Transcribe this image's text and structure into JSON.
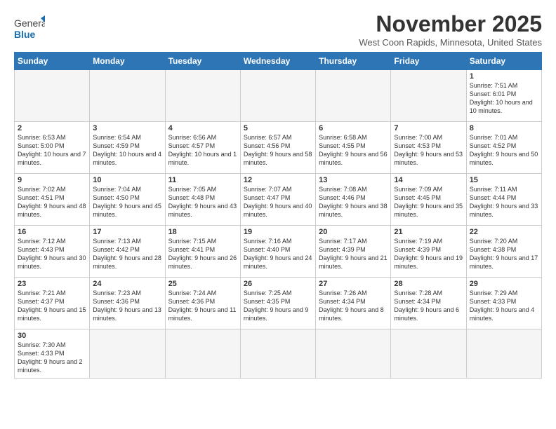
{
  "header": {
    "logo_general": "General",
    "logo_blue": "Blue",
    "month_title": "November 2025",
    "subtitle": "West Coon Rapids, Minnesota, United States"
  },
  "weekdays": [
    "Sunday",
    "Monday",
    "Tuesday",
    "Wednesday",
    "Thursday",
    "Friday",
    "Saturday"
  ],
  "weeks": [
    [
      {
        "day": "",
        "info": ""
      },
      {
        "day": "",
        "info": ""
      },
      {
        "day": "",
        "info": ""
      },
      {
        "day": "",
        "info": ""
      },
      {
        "day": "",
        "info": ""
      },
      {
        "day": "",
        "info": ""
      },
      {
        "day": "1",
        "info": "Sunrise: 7:51 AM\nSunset: 6:01 PM\nDaylight: 10 hours\nand 10 minutes."
      }
    ],
    [
      {
        "day": "2",
        "info": "Sunrise: 6:53 AM\nSunset: 5:00 PM\nDaylight: 10 hours\nand 7 minutes."
      },
      {
        "day": "3",
        "info": "Sunrise: 6:54 AM\nSunset: 4:59 PM\nDaylight: 10 hours\nand 4 minutes."
      },
      {
        "day": "4",
        "info": "Sunrise: 6:56 AM\nSunset: 4:57 PM\nDaylight: 10 hours\nand 1 minute."
      },
      {
        "day": "5",
        "info": "Sunrise: 6:57 AM\nSunset: 4:56 PM\nDaylight: 9 hours\nand 58 minutes."
      },
      {
        "day": "6",
        "info": "Sunrise: 6:58 AM\nSunset: 4:55 PM\nDaylight: 9 hours\nand 56 minutes."
      },
      {
        "day": "7",
        "info": "Sunrise: 7:00 AM\nSunset: 4:53 PM\nDaylight: 9 hours\nand 53 minutes."
      },
      {
        "day": "8",
        "info": "Sunrise: 7:01 AM\nSunset: 4:52 PM\nDaylight: 9 hours\nand 50 minutes."
      }
    ],
    [
      {
        "day": "9",
        "info": "Sunrise: 7:02 AM\nSunset: 4:51 PM\nDaylight: 9 hours\nand 48 minutes."
      },
      {
        "day": "10",
        "info": "Sunrise: 7:04 AM\nSunset: 4:50 PM\nDaylight: 9 hours\nand 45 minutes."
      },
      {
        "day": "11",
        "info": "Sunrise: 7:05 AM\nSunset: 4:48 PM\nDaylight: 9 hours\nand 43 minutes."
      },
      {
        "day": "12",
        "info": "Sunrise: 7:07 AM\nSunset: 4:47 PM\nDaylight: 9 hours\nand 40 minutes."
      },
      {
        "day": "13",
        "info": "Sunrise: 7:08 AM\nSunset: 4:46 PM\nDaylight: 9 hours\nand 38 minutes."
      },
      {
        "day": "14",
        "info": "Sunrise: 7:09 AM\nSunset: 4:45 PM\nDaylight: 9 hours\nand 35 minutes."
      },
      {
        "day": "15",
        "info": "Sunrise: 7:11 AM\nSunset: 4:44 PM\nDaylight: 9 hours\nand 33 minutes."
      }
    ],
    [
      {
        "day": "16",
        "info": "Sunrise: 7:12 AM\nSunset: 4:43 PM\nDaylight: 9 hours\nand 30 minutes."
      },
      {
        "day": "17",
        "info": "Sunrise: 7:13 AM\nSunset: 4:42 PM\nDaylight: 9 hours\nand 28 minutes."
      },
      {
        "day": "18",
        "info": "Sunrise: 7:15 AM\nSunset: 4:41 PM\nDaylight: 9 hours\nand 26 minutes."
      },
      {
        "day": "19",
        "info": "Sunrise: 7:16 AM\nSunset: 4:40 PM\nDaylight: 9 hours\nand 24 minutes."
      },
      {
        "day": "20",
        "info": "Sunrise: 7:17 AM\nSunset: 4:39 PM\nDaylight: 9 hours\nand 21 minutes."
      },
      {
        "day": "21",
        "info": "Sunrise: 7:19 AM\nSunset: 4:39 PM\nDaylight: 9 hours\nand 19 minutes."
      },
      {
        "day": "22",
        "info": "Sunrise: 7:20 AM\nSunset: 4:38 PM\nDaylight: 9 hours\nand 17 minutes."
      }
    ],
    [
      {
        "day": "23",
        "info": "Sunrise: 7:21 AM\nSunset: 4:37 PM\nDaylight: 9 hours\nand 15 minutes."
      },
      {
        "day": "24",
        "info": "Sunrise: 7:23 AM\nSunset: 4:36 PM\nDaylight: 9 hours\nand 13 minutes."
      },
      {
        "day": "25",
        "info": "Sunrise: 7:24 AM\nSunset: 4:36 PM\nDaylight: 9 hours\nand 11 minutes."
      },
      {
        "day": "26",
        "info": "Sunrise: 7:25 AM\nSunset: 4:35 PM\nDaylight: 9 hours\nand 9 minutes."
      },
      {
        "day": "27",
        "info": "Sunrise: 7:26 AM\nSunset: 4:34 PM\nDaylight: 9 hours\nand 8 minutes."
      },
      {
        "day": "28",
        "info": "Sunrise: 7:28 AM\nSunset: 4:34 PM\nDaylight: 9 hours\nand 6 minutes."
      },
      {
        "day": "29",
        "info": "Sunrise: 7:29 AM\nSunset: 4:33 PM\nDaylight: 9 hours\nand 4 minutes."
      }
    ],
    [
      {
        "day": "30",
        "info": "Sunrise: 7:30 AM\nSunset: 4:33 PM\nDaylight: 9 hours\nand 2 minutes."
      },
      {
        "day": "",
        "info": ""
      },
      {
        "day": "",
        "info": ""
      },
      {
        "day": "",
        "info": ""
      },
      {
        "day": "",
        "info": ""
      },
      {
        "day": "",
        "info": ""
      },
      {
        "day": "",
        "info": ""
      }
    ]
  ]
}
